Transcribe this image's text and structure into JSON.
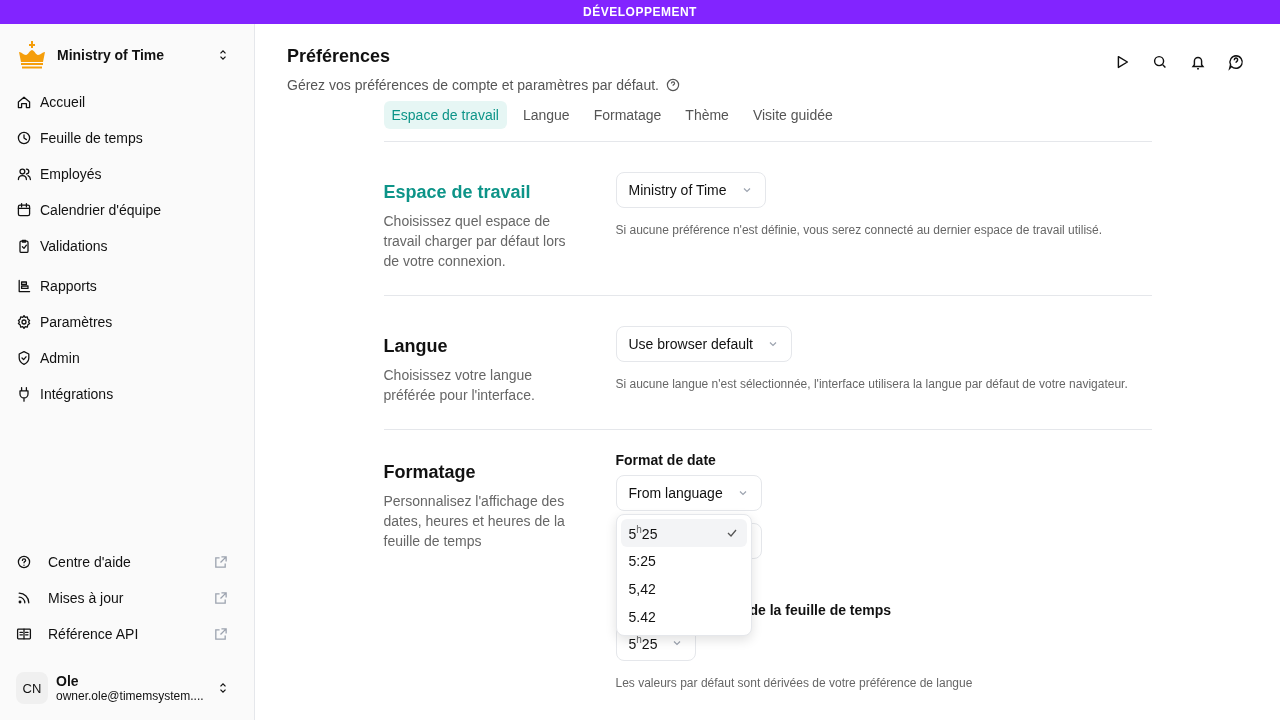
{
  "banner": {
    "label": "DÉVELOPPEMENT"
  },
  "sidebar": {
    "workspace": "Ministry of Time",
    "items": [
      {
        "label": "Accueil"
      },
      {
        "label": "Feuille de temps"
      },
      {
        "label": "Employés"
      },
      {
        "label": "Calendrier d'équipe"
      },
      {
        "label": "Validations"
      },
      {
        "label": "Rapports"
      },
      {
        "label": "Paramètres"
      },
      {
        "label": "Admin"
      },
      {
        "label": "Intégrations"
      }
    ],
    "links": [
      {
        "label": "Centre d'aide"
      },
      {
        "label": "Mises à jour"
      },
      {
        "label": "Référence API"
      }
    ],
    "user": {
      "initials": "CN",
      "name": "Ole",
      "email": "owner.ole@timemsystem...."
    }
  },
  "header": {
    "title": "Préférences",
    "subtitle": "Gérez vos préférences de compte et paramètres par défaut."
  },
  "tabs": [
    {
      "label": "Espace de travail",
      "selected": true
    },
    {
      "label": "Langue",
      "selected": false
    },
    {
      "label": "Formatage",
      "selected": false
    },
    {
      "label": "Thème",
      "selected": false
    },
    {
      "label": "Visite guidée",
      "selected": false
    }
  ],
  "sections": [
    {
      "title": "Espace de travail",
      "highlighted": true,
      "description": "Choisissez quel espace de travail charger par défaut lors de votre connexion.",
      "fields": [
        {
          "value": "Ministry of Time"
        }
      ],
      "hint": "Si aucune préférence n'est définie, vous serez connecté au dernier espace de travail utilisé."
    },
    {
      "title": "Langue",
      "highlighted": false,
      "description": "Choisissez votre langue préférée pour l'interface.",
      "fields": [
        {
          "value": "Use browser default"
        }
      ],
      "hint": "Si aucune langue n'est sélectionnée, l'interface utilisera la langue par défaut de votre navigateur."
    },
    {
      "title": "Formatage",
      "highlighted": false,
      "description": "Personnalisez l'affichage des dates, heures et heures de la feuille de temps",
      "fields": [
        {
          "label": "Format de date",
          "value": "From language"
        },
        {
          "label": "de la feuille de temps",
          "value": "5$^{h}$25"
        }
      ],
      "hint": "Les valeurs par défaut sont dérivées de votre préférence de langue"
    }
  ],
  "dropdown": {
    "options": [
      {
        "label": "5$^{h}$25",
        "selected": true
      },
      {
        "label": "5:25",
        "selected": false
      },
      {
        "label": "5,42",
        "selected": false
      },
      {
        "label": "5.42",
        "selected": false
      }
    ]
  }
}
